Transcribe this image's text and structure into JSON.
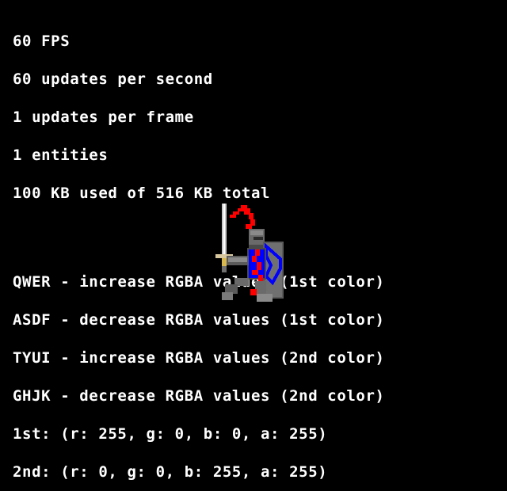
{
  "stats": {
    "fps": "60 FPS",
    "updates_per_second": "60 updates per second",
    "updates_per_frame": "1 updates per frame",
    "entities": "1 entities",
    "memory": "100 KB used of 516 KB total"
  },
  "controls": {
    "qwer": "QWER - increase RGBA values (1st color)",
    "asdf": "ASDF - decrease RGBA values (1st color)",
    "tyui": "TYUI - increase RGBA values (2nd color)",
    "ghjk": "GHJK - decrease RGBA values (2nd color)"
  },
  "colors": {
    "first_label": "1st: (r: 255, g: 0, b: 0, a: 255)",
    "second_label": "2nd: (r: 0, g: 0, b: 255, a: 255)",
    "first_hex": "#ff0000",
    "second_hex": "#0000ff",
    "text_hex": "#ffffff",
    "background_hex": "#000000"
  },
  "sprite": {
    "icon": "knight-sprite-icon"
  }
}
